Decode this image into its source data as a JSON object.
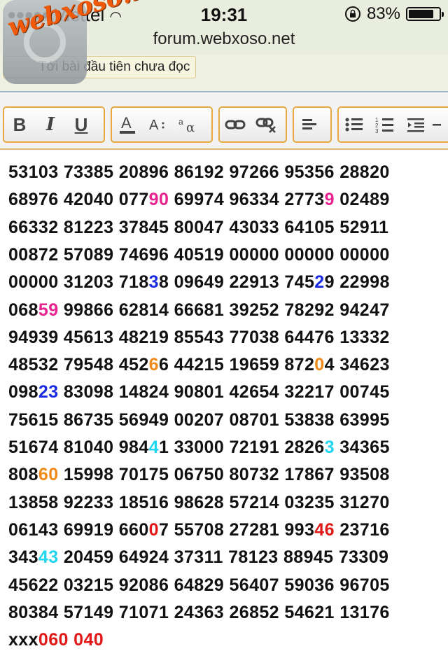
{
  "status": {
    "carrier": "Viettel",
    "time": "19:31",
    "battery": "83%",
    "battery_level": 0.83
  },
  "browser": {
    "url": "forum.webxoso.net"
  },
  "forum": {
    "unread_label": "Tới bài đầu tiên chưa đọc"
  },
  "watermark": {
    "text": "webxoso.net"
  },
  "toolbar": {
    "bold": "B",
    "italic": "I",
    "underline": "U",
    "icons": [
      "bold-icon",
      "italic-icon",
      "underline-icon",
      "font-color-icon",
      "font-size-icon",
      "font-family-icon",
      "link-icon",
      "unlink-icon",
      "align-left-icon",
      "bullet-list-icon",
      "numbered-list-icon",
      "indent-icon",
      "outdent-icon"
    ]
  },
  "colors": {
    "pink": "#e8238f",
    "blue": "#1a2ae0",
    "orange": "#f08a1a",
    "red": "#e01818",
    "cyan": "#1fd6ee"
  },
  "lines": [
    [
      {
        "t": "53103 73385 20896 86192 97266 95356 28820"
      }
    ],
    [
      {
        "t": "68976 42040 077"
      },
      {
        "t": "90",
        "c": "pink"
      },
      {
        "t": " 69974 96334 2773"
      },
      {
        "t": "9",
        "c": "pink"
      },
      {
        "t": " 02489"
      }
    ],
    [
      {
        "t": "66332 81223 37845 80047 43033 64105 52911"
      }
    ],
    [
      {
        "t": "00872 57089 74696 40519 00000 00000 00000"
      }
    ],
    [
      {
        "t": "00000 31203 718"
      },
      {
        "t": "3",
        "c": "blue"
      },
      {
        "t": "8 09649 22913 745"
      },
      {
        "t": "2",
        "c": "blue"
      },
      {
        "t": "9 22998"
      }
    ],
    [
      {
        "t": "068"
      },
      {
        "t": "59",
        "c": "pink"
      },
      {
        "t": " 99866 62814 66681 39252 78292 94247"
      }
    ],
    [
      {
        "t": "94939 45613 48219 85543 77038 64476 13332"
      }
    ],
    [
      {
        "t": "48532 79548 452"
      },
      {
        "t": "6",
        "c": "orange"
      },
      {
        "t": "6 44215 19659 872"
      },
      {
        "t": "0",
        "c": "orange"
      },
      {
        "t": "4 34623"
      }
    ],
    [
      {
        "t": "098"
      },
      {
        "t": "23",
        "c": "blue"
      },
      {
        "t": " 83098 14824 90801 42654 32217 00745"
      }
    ],
    [
      {
        "t": "75615 86735 56949 00207 08701 53838 63995"
      }
    ],
    [
      {
        "t": "51674 81040 984"
      },
      {
        "t": "4",
        "c": "cyan"
      },
      {
        "t": "1 33000 72191 2826"
      },
      {
        "t": "3",
        "c": "cyan"
      },
      {
        "t": " 34365"
      }
    ],
    [
      {
        "t": "808"
      },
      {
        "t": "60",
        "c": "orange"
      },
      {
        "t": " 15998 70175 06750 80732 17867 93508"
      }
    ],
    [
      {
        "t": "13858 92233 18516 98628 57214 03235 31270"
      }
    ],
    [
      {
        "t": "06143 69919 660"
      },
      {
        "t": "0",
        "c": "red"
      },
      {
        "t": "7 55708 27281 993"
      },
      {
        "t": "46",
        "c": "red"
      },
      {
        "t": " 23716"
      }
    ],
    [
      {
        "t": "343"
      },
      {
        "t": "43",
        "c": "cyan"
      },
      {
        "t": " 20459 64924 37311 78123 88945 73309"
      }
    ],
    [
      {
        "t": "45622 03215 92086 64829 56407 59036 96705"
      }
    ],
    [
      {
        "t": "80384 57149 71071 24363 26852 54621 13176"
      }
    ],
    [
      {
        "t": "xxx"
      },
      {
        "t": "060 040",
        "c": "red"
      }
    ]
  ]
}
